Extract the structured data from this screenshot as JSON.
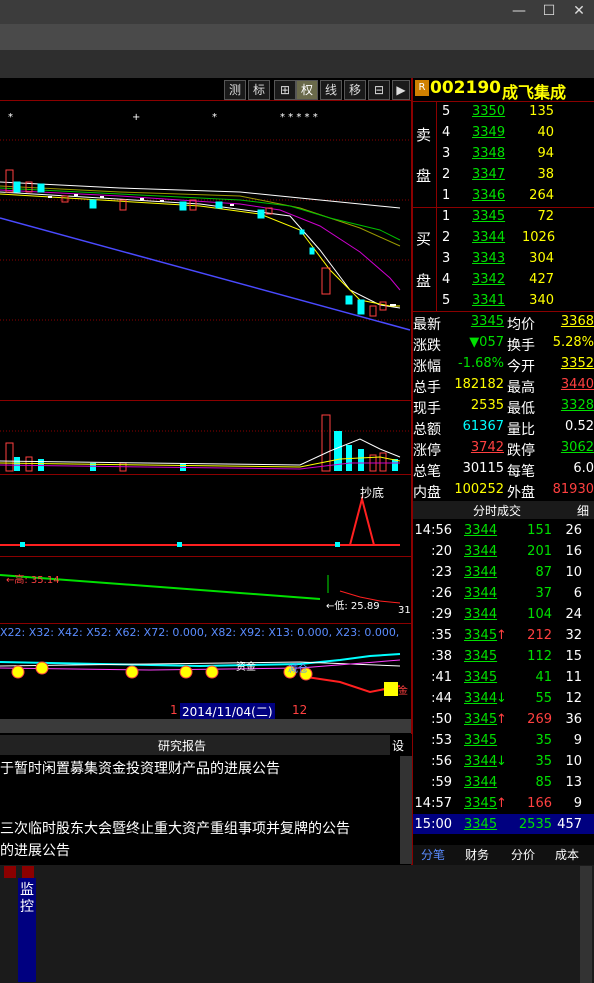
{
  "window": {
    "minimize": "—",
    "maximize": "☐",
    "close": "✕"
  },
  "toolbar": {
    "buttons": [
      "测",
      "标",
      "⊞",
      "权",
      "线",
      "移",
      "⊟",
      "▶"
    ]
  },
  "stock": {
    "badge": "R",
    "code": "002190",
    "name": "成飞集成"
  },
  "sell_label": [
    "卖",
    "盘"
  ],
  "buy_label": [
    "买",
    "盘"
  ],
  "sell_orders": [
    {
      "level": "5",
      "price": "3350",
      "vol": "135"
    },
    {
      "level": "4",
      "price": "3349",
      "vol": "40"
    },
    {
      "level": "3",
      "price": "3348",
      "vol": "94"
    },
    {
      "level": "2",
      "price": "3347",
      "vol": "38"
    },
    {
      "level": "1",
      "price": "3346",
      "vol": "264"
    }
  ],
  "buy_orders": [
    {
      "level": "1",
      "price": "3345",
      "vol": "72"
    },
    {
      "level": "2",
      "price": "3344",
      "vol": "1026"
    },
    {
      "level": "3",
      "price": "3343",
      "vol": "304"
    },
    {
      "level": "4",
      "price": "3342",
      "vol": "427"
    },
    {
      "level": "5",
      "price": "3341",
      "vol": "340"
    }
  ],
  "stats": [
    {
      "l1": "最新",
      "v1": "3345",
      "l2": "均价",
      "v2": "3368"
    },
    {
      "l1": "涨跌",
      "v1": "▼057",
      "l2": "换手",
      "v2": "5.28%"
    },
    {
      "l1": "涨幅",
      "v1": "-1.68%",
      "l2": "今开",
      "v2": "3352"
    },
    {
      "l1": "总手",
      "v1": "182182",
      "l2": "最高",
      "v2": "3440"
    },
    {
      "l1": "现手",
      "v1": "2535",
      "l2": "最低",
      "v2": "3328"
    },
    {
      "l1": "总额",
      "v1": "61367",
      "l2": "量比",
      "v2": "0.52"
    },
    {
      "l1": "涨停",
      "v1": "3742",
      "l2": "跌停",
      "v2": "3062"
    },
    {
      "l1": "总笔",
      "v1": "30115",
      "l2": "每笔",
      "v2": "6.0"
    },
    {
      "l1": "内盘",
      "v1": "100252",
      "l2": "外盘",
      "v2": "81930"
    }
  ],
  "ticks_header": {
    "title": "分时成交",
    "detail": "细"
  },
  "ticks": [
    {
      "time": "14:56",
      "price": "3344",
      "arrow": "",
      "vol": "151",
      "n": "26"
    },
    {
      "time": ":20",
      "price": "3344",
      "arrow": "",
      "vol": "201",
      "n": "16"
    },
    {
      "time": ":23",
      "price": "3344",
      "arrow": "",
      "vol": "87",
      "n": "10"
    },
    {
      "time": ":26",
      "price": "3344",
      "arrow": "",
      "vol": "37",
      "n": "6"
    },
    {
      "time": ":29",
      "price": "3344",
      "arrow": "",
      "vol": "104",
      "n": "24"
    },
    {
      "time": ":35",
      "price": "3345",
      "arrow": "↑",
      "vol": "212",
      "n": "32"
    },
    {
      "time": ":38",
      "price": "3345",
      "arrow": "",
      "vol": "112",
      "n": "15"
    },
    {
      "time": ":41",
      "price": "3345",
      "arrow": "",
      "vol": "41",
      "n": "11"
    },
    {
      "time": ":44",
      "price": "3344",
      "arrow": "↓",
      "vol": "55",
      "n": "12"
    },
    {
      "time": ":50",
      "price": "3345",
      "arrow": "↑",
      "vol": "269",
      "n": "36"
    },
    {
      "time": ":53",
      "price": "3345",
      "arrow": "",
      "vol": "35",
      "n": "9"
    },
    {
      "time": ":56",
      "price": "3344",
      "arrow": "↓",
      "vol": "35",
      "n": "10"
    },
    {
      "time": ":59",
      "price": "3344",
      "arrow": "",
      "vol": "85",
      "n": "13"
    },
    {
      "time": "14:57",
      "price": "3345",
      "arrow": "↑",
      "vol": "166",
      "n": "9"
    },
    {
      "time": "15:00",
      "price": "3345",
      "arrow": "",
      "vol": "2535",
      "n": "457"
    }
  ],
  "bottom_tabs": [
    "分笔",
    "财务",
    "分价",
    "成本"
  ],
  "chart_labels": {
    "signal": "抄底",
    "high_marker": "←高: 35.14",
    "low_marker": "←低: 25.89",
    "low_tail": "31",
    "indicator_line": "X22: X32: X42: X52: X62: X72: 0.000, X82: X92: X13: 0.000, X23: 0.000,",
    "date": "2014/11/04(二)",
    "left_mark": "1",
    "right_mark": "12",
    "annot1": "资金",
    "annot2": "减仓",
    "annot3": "金"
  },
  "news": {
    "title": "研究报告",
    "settings": "设",
    "items": [
      "于暂时闲置募集资金投资理财产品的进展公告",
      "",
      "三次临时股东大会暨终止重大资产重组事项并复牌的公告",
      "的进展公告"
    ]
  },
  "dock": {
    "monitor": "监控"
  },
  "colors": {
    "up": "#ff4040",
    "down": "#00e000",
    "accent": "#ffff00",
    "frame": "#8b0000"
  }
}
